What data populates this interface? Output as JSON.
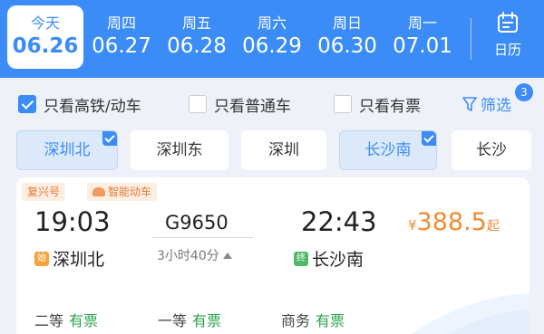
{
  "date_bar": {
    "dates": [
      {
        "dow": "今天",
        "date": "06.26",
        "selected": true
      },
      {
        "dow": "周四",
        "date": "06.27"
      },
      {
        "dow": "周五",
        "date": "06.28"
      },
      {
        "dow": "周六",
        "date": "06.29"
      },
      {
        "dow": "周日",
        "date": "06.30"
      },
      {
        "dow": "周一",
        "date": "07.01"
      }
    ],
    "calendar_label": "日历"
  },
  "filters": {
    "items": [
      {
        "label": "只看高铁/动车",
        "checked": true
      },
      {
        "label": "只看普通车",
        "checked": false
      },
      {
        "label": "只看有票",
        "checked": false
      }
    ],
    "filter_label": "筛选",
    "filter_badge": "3"
  },
  "stations": [
    {
      "name": "深圳北",
      "selected": true
    },
    {
      "name": "深圳东",
      "selected": false
    },
    {
      "name": "深圳",
      "selected": false
    },
    {
      "name": "长沙南",
      "selected": true
    },
    {
      "name": "长沙",
      "selected": false
    }
  ],
  "train": {
    "tags": [
      "复兴号",
      "智能动车"
    ],
    "depart_time": "19:03",
    "arrive_time": "22:43",
    "train_no": "G9650",
    "duration": "3小时40分",
    "price_symbol": "¥",
    "price": "388.5",
    "price_suffix": "起",
    "from_station": "深圳北",
    "from_marker": "始",
    "to_station": "长沙南",
    "to_marker": "终",
    "seats": [
      {
        "class": "二等",
        "status": "有票"
      },
      {
        "class": "一等",
        "status": "有票"
      },
      {
        "class": "商务",
        "status": "有票"
      }
    ]
  },
  "colors": {
    "accent": "#3b8cf7",
    "price": "#f08a34",
    "available": "#2aa24a"
  }
}
